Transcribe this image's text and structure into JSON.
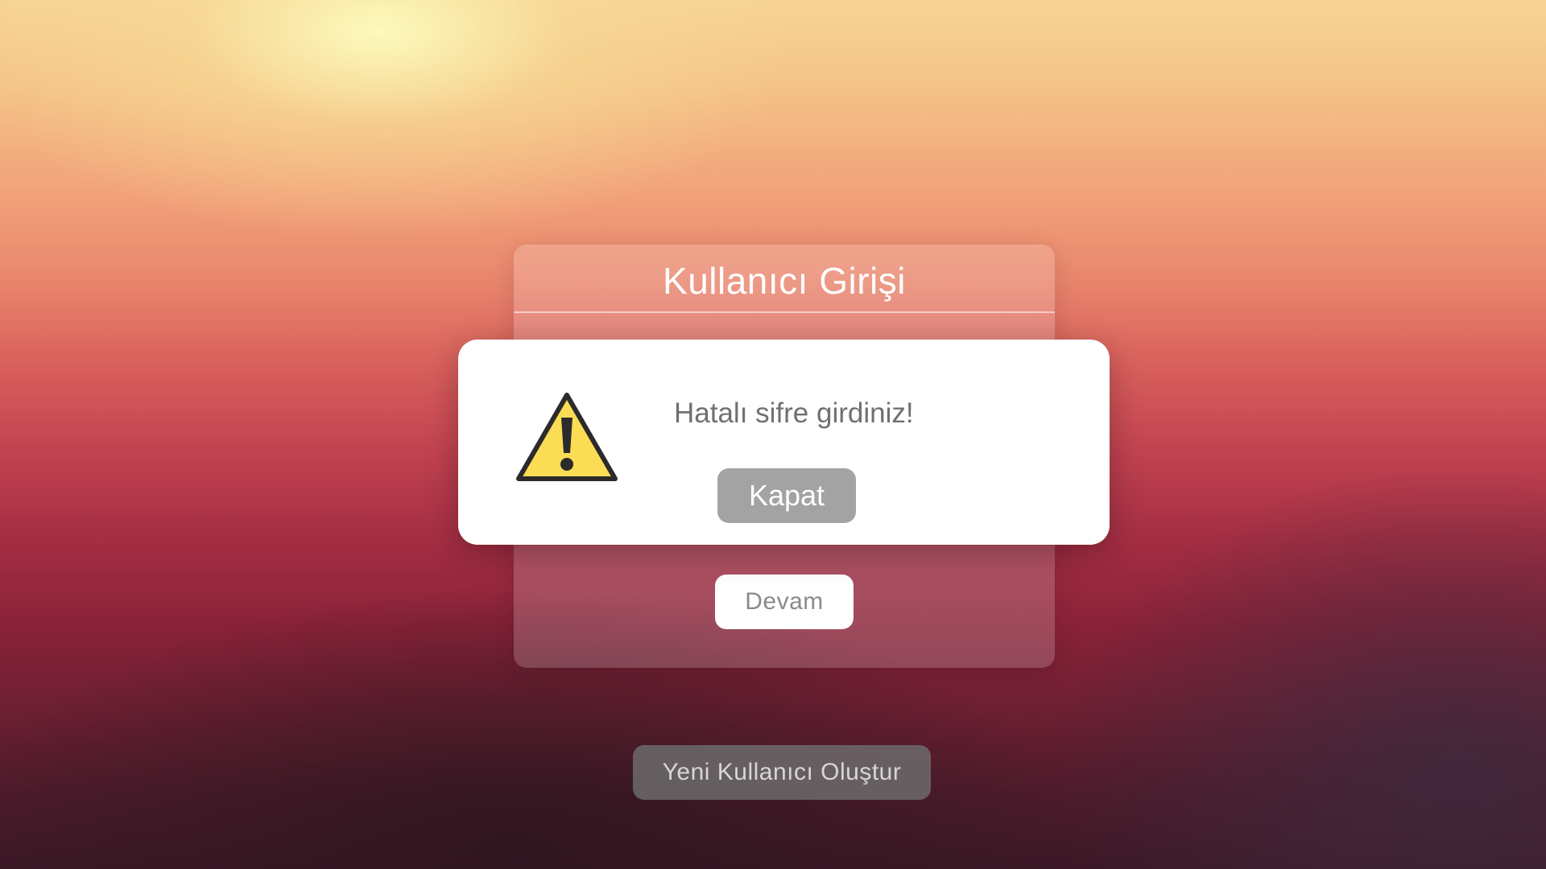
{
  "login": {
    "title": "Kullanıcı Girişi",
    "continue_label": "Devam",
    "create_user_label": "Yeni Kullanıcı Oluştur"
  },
  "alert": {
    "icon": "warning-triangle-icon",
    "message": "Hatalı sifre girdiniz!",
    "close_label": "Kapat"
  },
  "colors": {
    "warning_fill": "#fbdc55",
    "warning_stroke": "#2b2b2b",
    "close_button": "#a3a3a3",
    "create_user_button": "#6e6e6e"
  }
}
